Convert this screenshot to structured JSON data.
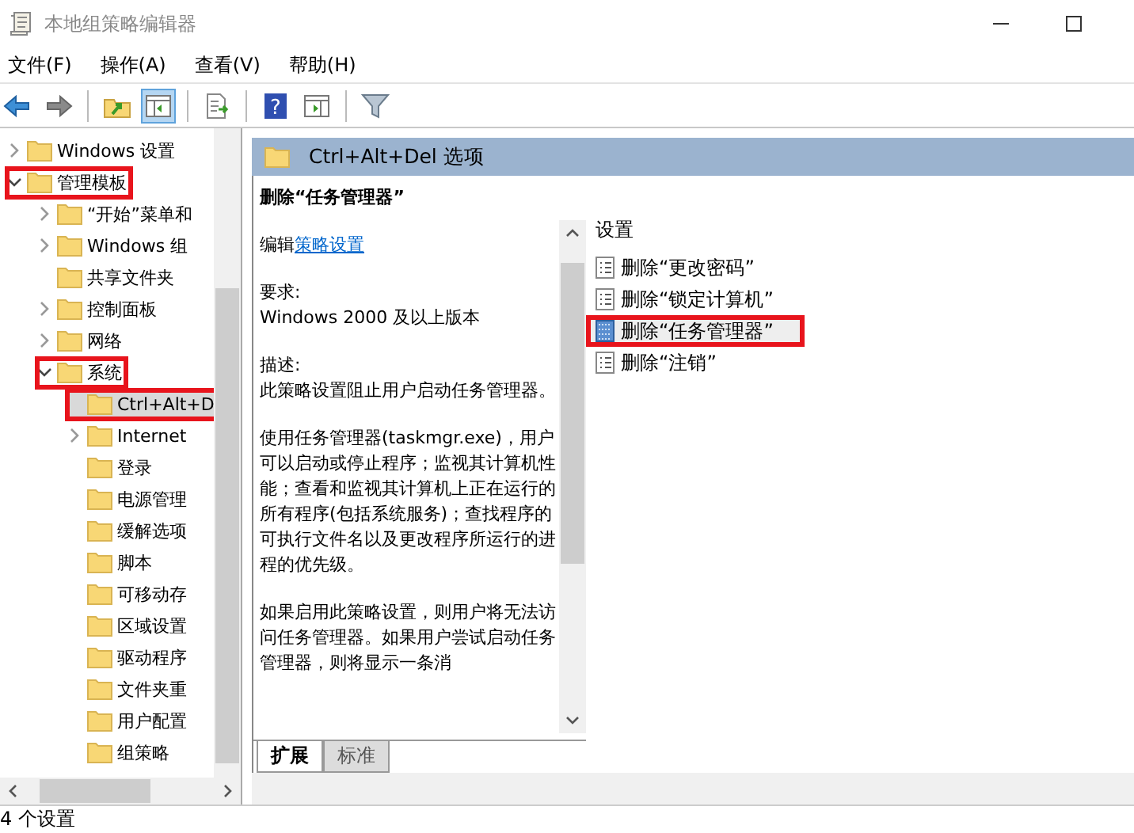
{
  "window": {
    "title": "本地组策略编辑器"
  },
  "menu": [
    "文件(F)",
    "操作(A)",
    "查看(V)",
    "帮助(H)"
  ],
  "toolbar": [
    {
      "kind": "back",
      "pressed": false
    },
    {
      "kind": "forward",
      "pressed": false
    },
    {
      "kind": "sep"
    },
    {
      "kind": "up",
      "pressed": false
    },
    {
      "kind": "tree",
      "pressed": true
    },
    {
      "kind": "sep"
    },
    {
      "kind": "export",
      "pressed": false
    },
    {
      "kind": "sep"
    },
    {
      "kind": "help",
      "pressed": false,
      "label": "?"
    },
    {
      "kind": "pane",
      "pressed": false
    },
    {
      "kind": "sep"
    },
    {
      "kind": "filter",
      "pressed": false
    }
  ],
  "tree": [
    {
      "label": "Windows 设置",
      "expandable": true,
      "expanded": false,
      "selected": false,
      "highlighted": false
    },
    {
      "label": "管理模板",
      "expandable": true,
      "expanded": true,
      "selected": false,
      "highlighted": true,
      "children": [
        {
          "label": "“开始”菜单和",
          "expandable": true,
          "expanded": false,
          "selected": false,
          "highlighted": false
        },
        {
          "label": "Windows 组",
          "expandable": true,
          "expanded": false,
          "selected": false,
          "highlighted": false
        },
        {
          "label": "共享文件夹",
          "expandable": false,
          "expanded": false,
          "selected": false,
          "highlighted": false
        },
        {
          "label": "控制面板",
          "expandable": true,
          "expanded": false,
          "selected": false,
          "highlighted": false
        },
        {
          "label": "网络",
          "expandable": true,
          "expanded": false,
          "selected": false,
          "highlighted": false
        },
        {
          "label": "系统",
          "expandable": true,
          "expanded": true,
          "selected": false,
          "highlighted": true,
          "children": [
            {
              "label": "Ctrl+Alt+D",
              "expandable": false,
              "expanded": false,
              "selected": true,
              "highlighted": true
            },
            {
              "label": "Internet",
              "expandable": true,
              "expanded": false,
              "selected": false,
              "highlighted": false
            },
            {
              "label": "登录",
              "expandable": false,
              "expanded": false,
              "selected": false,
              "highlighted": false
            },
            {
              "label": "电源管理",
              "expandable": false,
              "expanded": false,
              "selected": false,
              "highlighted": false
            },
            {
              "label": "缓解选项",
              "expandable": false,
              "expanded": false,
              "selected": false,
              "highlighted": false
            },
            {
              "label": "脚本",
              "expandable": false,
              "expanded": false,
              "selected": false,
              "highlighted": false
            },
            {
              "label": "可移动存",
              "expandable": false,
              "expanded": false,
              "selected": false,
              "highlighted": false
            },
            {
              "label": "区域设置",
              "expandable": false,
              "expanded": false,
              "selected": false,
              "highlighted": false
            },
            {
              "label": "驱动程序",
              "expandable": false,
              "expanded": false,
              "selected": false,
              "highlighted": false
            },
            {
              "label": "文件夹重",
              "expandable": false,
              "expanded": false,
              "selected": false,
              "highlighted": false
            },
            {
              "label": "用户配置",
              "expandable": false,
              "expanded": false,
              "selected": false,
              "highlighted": false
            },
            {
              "label": "组策略",
              "expandable": false,
              "expanded": false,
              "selected": false,
              "highlighted": false
            }
          ]
        }
      ]
    }
  ],
  "header": {
    "title": "Ctrl+Alt+Del 选项"
  },
  "description": {
    "title": "删除“任务管理器”",
    "edit_prefix": "编辑",
    "edit_link": "策略设置",
    "requirement_label": "要求:",
    "requirement": "Windows 2000 及以上版本",
    "description_label": "描述:",
    "paragraphs": [
      "此策略设置阻止用户启动任务管理器。",
      "使用任务管理器(taskmgr.exe)，用户可以启动或停止程序；监视其计算机性能；查看和监视其计算机上正在运行的所有程序(包括系统服务)；查找程序的可执行文件名以及更改程序所运行的进程的优先级。",
      "如果启用此策略设置，则用户将无法访问任务管理器。如果用户尝试启动任务管理器，则将显示一条消"
    ]
  },
  "settings": {
    "column": "设置",
    "items": [
      {
        "label": "删除“更改密码”",
        "selected": false,
        "highlighted": false
      },
      {
        "label": "删除“锁定计算机”",
        "selected": false,
        "highlighted": false
      },
      {
        "label": "删除“任务管理器”",
        "selected": true,
        "highlighted": true
      },
      {
        "label": "删除“注销”",
        "selected": false,
        "highlighted": false
      }
    ]
  },
  "tabs": [
    {
      "label": "扩展",
      "selected": true
    },
    {
      "label": "标准",
      "selected": false
    }
  ],
  "status_bar": "4 个设置"
}
